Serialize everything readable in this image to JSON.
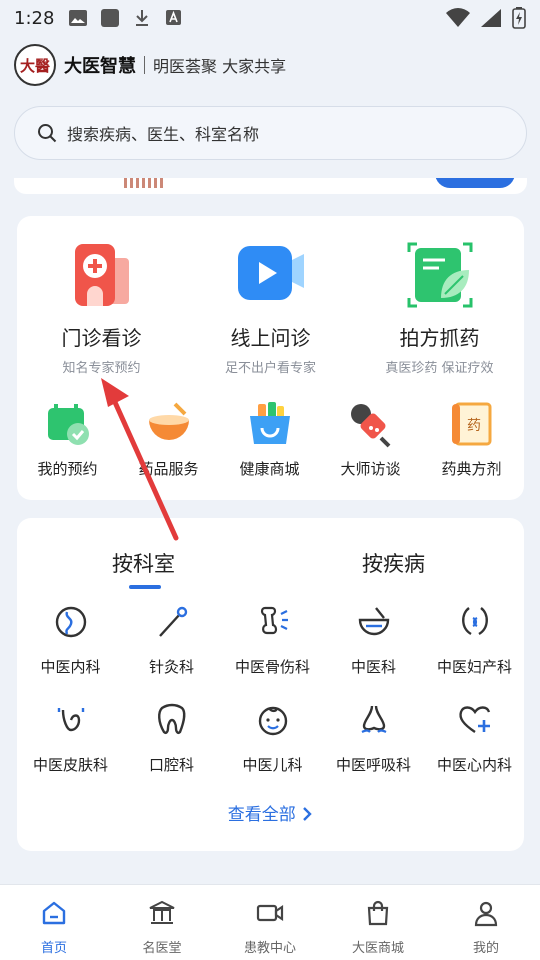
{
  "status_bar": {
    "time": "1:28"
  },
  "brand": {
    "logo_text": "大醫",
    "name": "大医智慧",
    "slogan": "明医荟聚 大家共享"
  },
  "search": {
    "placeholder": "搜索疾病、医生、科室名称"
  },
  "services": {
    "primary": [
      {
        "title": "门诊看诊",
        "subtitle": "知名专家预约"
      },
      {
        "title": "线上问诊",
        "subtitle": "足不出户看专家"
      },
      {
        "title": "拍方抓药",
        "subtitle": "真医珍药 保证疗效"
      }
    ],
    "secondary": [
      {
        "label": "我的预约"
      },
      {
        "label": "药品服务"
      },
      {
        "label": "健康商城"
      },
      {
        "label": "大师访谈"
      },
      {
        "label": "药典方剂"
      }
    ]
  },
  "departments": {
    "tabs": [
      "按科室",
      "按疾病"
    ],
    "active_tab": "按科室",
    "items": [
      {
        "label": "中医内科",
        "icon": "stomach-icon"
      },
      {
        "label": "针灸科",
        "icon": "needle-icon"
      },
      {
        "label": "中医骨伤科",
        "icon": "bone-icon"
      },
      {
        "label": "中医科",
        "icon": "mortar-icon"
      },
      {
        "label": "中医妇产科",
        "icon": "uterus-icon"
      },
      {
        "label": "中医皮肤科",
        "icon": "skin-icon"
      },
      {
        "label": "口腔科",
        "icon": "tooth-icon"
      },
      {
        "label": "中医儿科",
        "icon": "baby-icon"
      },
      {
        "label": "中医呼吸科",
        "icon": "nose-icon"
      },
      {
        "label": "中医心内科",
        "icon": "heart-plus-icon"
      }
    ],
    "view_all": "查看全部"
  },
  "bottom_nav": [
    {
      "label": "首页",
      "active": true
    },
    {
      "label": "名医堂",
      "active": false
    },
    {
      "label": "患教中心",
      "active": false
    },
    {
      "label": "大医商城",
      "active": false
    },
    {
      "label": "我的",
      "active": false
    }
  ],
  "colors": {
    "accent": "#2b6fe0",
    "annotation_arrow": "#e23b3b"
  }
}
